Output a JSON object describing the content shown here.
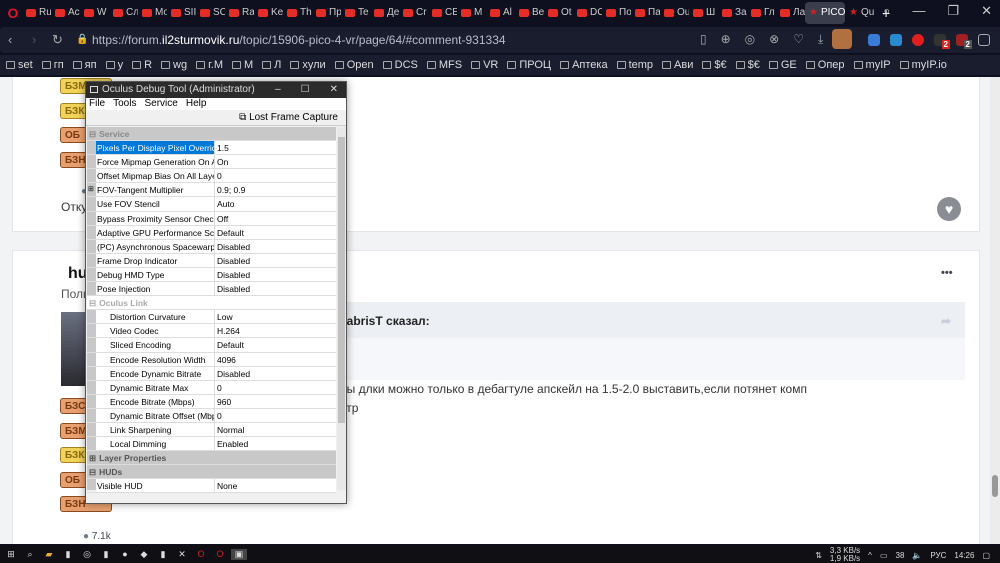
{
  "browser": {
    "tabs": [
      "Ru",
      "Ac",
      "W",
      "Cл",
      "Mo",
      "SII",
      "SC",
      "Ra",
      "Ke",
      "Th",
      "Пр",
      "Te",
      "Де",
      "Cr",
      "CE",
      "M",
      "Al",
      "Be",
      "Ot",
      "DC",
      "По",
      "Па",
      "Ou",
      "Ш",
      "За",
      "Гл",
      "Ла",
      "PICO",
      "Qu"
    ],
    "active_tab": "PICO",
    "url_prefix": "https://forum.",
    "url_domain": "il2sturmovik.ru",
    "url_path": "/topic/15906-pico-4-vr/page/64/#comment-931334",
    "bookmarks": [
      "set",
      "гп",
      "яп",
      "у",
      "R",
      "wg",
      "г.М",
      "М",
      "Л",
      "хули",
      "Open",
      "DCS",
      "MFS",
      "VR",
      "ПРОЦ",
      "Аптека",
      "temp",
      "Ави",
      "$€",
      "$€",
      "GE",
      "Опер",
      "myIP",
      "myIP.io"
    ],
    "ext_badges": [
      "2",
      "2"
    ]
  },
  "page": {
    "badges_top": [
      "БЗМ",
      "БЗК",
      "ОБ",
      "БЗН"
    ],
    "location_label": "Отку",
    "author": "hu",
    "role": "Поль",
    "badges_bottom": [
      "БЗС",
      "БЗМ",
      "БЗК",
      "ОБ",
      "БЗН"
    ],
    "quote_author": "cabrisT сказал:",
    "post_line1": "ны длки можно только в дебагтуле апскейл на 1.5-2.0 выставить,если потянет комп",
    "post_line2": "етр",
    "comments_count": "7.1k"
  },
  "odt": {
    "title": "Oculus Debug Tool (Administrator)",
    "menu": [
      "File",
      "Tools",
      "Service",
      "Help"
    ],
    "lost_frame": "Lost Frame Capture",
    "rows": [
      {
        "type": "cat",
        "label": "Service",
        "exp": "⊟"
      },
      {
        "key": "Pixels Per Display Pixel Override",
        "val": "1.5",
        "sel": true
      },
      {
        "key": "Force Mipmap Generation On All L",
        "val": "On"
      },
      {
        "key": "Offset Mipmap Bias On All Layers",
        "val": "0"
      },
      {
        "key": "FOV-Tangent Multiplier",
        "val": "0.9; 0.9",
        "exp": "⊞"
      },
      {
        "key": "Use FOV Stencil",
        "val": "Auto"
      },
      {
        "key": "Bypass Proximity Sensor Check",
        "val": "Off"
      },
      {
        "key": "Adaptive GPU Performance Scale",
        "val": "Default"
      },
      {
        "key": "(PC) Asynchronous Spacewarp",
        "val": "Disabled"
      },
      {
        "key": "Frame Drop Indicator",
        "val": "Disabled"
      },
      {
        "key": "Debug HMD Type",
        "val": "Disabled"
      },
      {
        "key": "Pose Injection",
        "val": "Disabled"
      },
      {
        "type": "cat",
        "label": "Oculus Link",
        "exp": "⊟",
        "light": true
      },
      {
        "key": "Distortion Curvature",
        "val": "Low",
        "sub": true
      },
      {
        "key": "Video Codec",
        "val": "H.264",
        "sub": true
      },
      {
        "key": "Sliced Encoding",
        "val": "Default",
        "sub": true
      },
      {
        "key": "Encode Resolution Width",
        "val": "4096",
        "sub": true
      },
      {
        "key": "Encode Dynamic Bitrate",
        "val": "Disabled",
        "sub": true
      },
      {
        "key": "Dynamic Bitrate Max",
        "val": "0",
        "sub": true
      },
      {
        "key": "Encode Bitrate (Mbps)",
        "val": "960",
        "sub": true
      },
      {
        "key": "Dynamic Bitrate Offset (Mbps)",
        "val": "0",
        "sub": true
      },
      {
        "key": "Link Sharpening",
        "val": "Normal",
        "sub": true
      },
      {
        "key": "Local Dimming",
        "val": "Enabled",
        "sub": true
      },
      {
        "type": "cat",
        "label": "Layer Properties",
        "exp": "⊞",
        "dark": true
      },
      {
        "type": "cat",
        "label": "HUDs",
        "exp": "⊟",
        "dark": true
      },
      {
        "key": "Visible HUD",
        "val": "None"
      }
    ]
  },
  "taskbar": {
    "net_up": "3,3 KB/s",
    "net_down": "1,9 KB/s",
    "temp": "38",
    "lang": "РУС",
    "time": "14:26"
  }
}
